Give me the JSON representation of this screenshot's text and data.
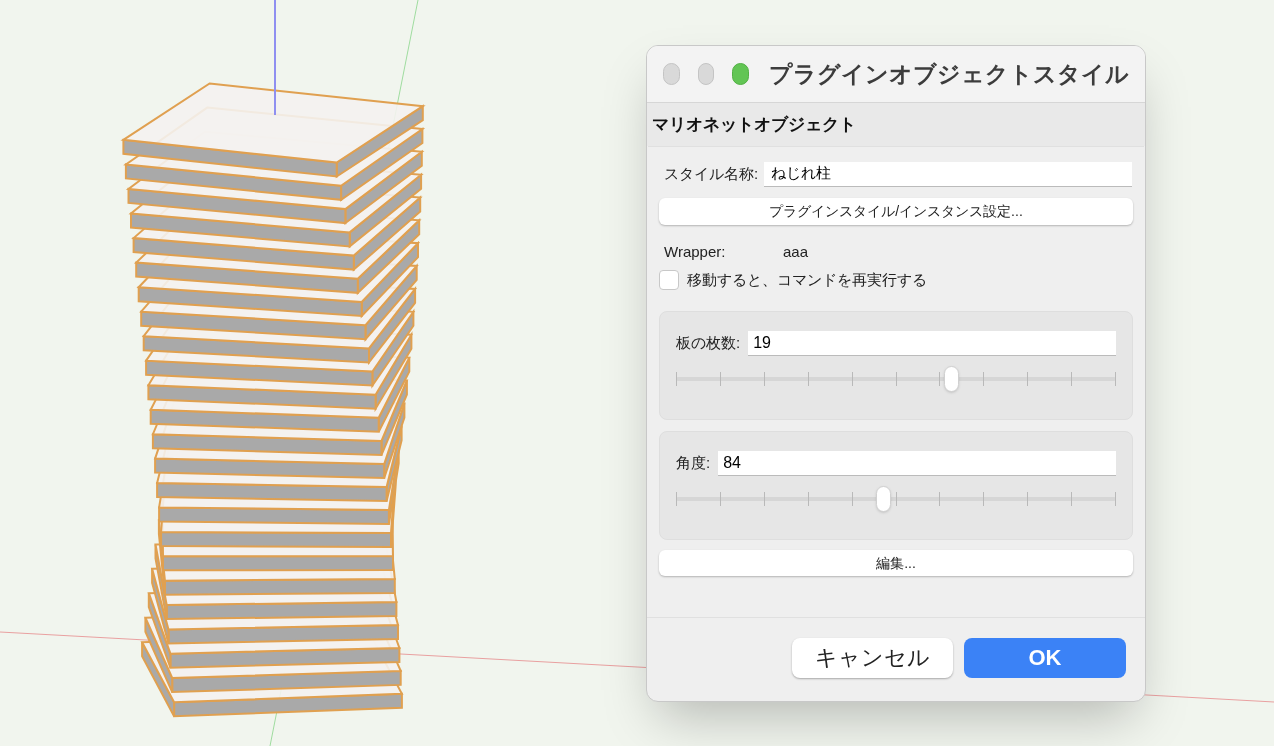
{
  "window": {
    "title": "プラグインオブジェクトスタイル"
  },
  "section_header": "マリオネットオブジェクト",
  "style_name": {
    "label": "スタイル名称:",
    "value": "ねじれ柱"
  },
  "style_button": "プラグインスタイル/インスタンス設定...",
  "wrapper": {
    "label": "Wrapper:",
    "value": "aaa"
  },
  "rerun_checkbox": {
    "label": "移動すると、コマンドを再実行する",
    "checked": false
  },
  "parameters": [
    {
      "label": "板の枚数:",
      "value": "19",
      "level": 0.63
    },
    {
      "label": "角度:",
      "value": "84",
      "level": 0.47
    }
  ],
  "edit_button": "編集...",
  "buttons": [
    {
      "label": "キャンセル",
      "primary": false
    },
    {
      "label": "OK",
      "primary": true
    }
  ]
}
